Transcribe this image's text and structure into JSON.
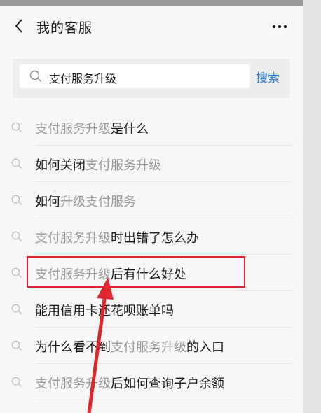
{
  "navbar": {
    "title": "我的客服",
    "back_icon": "chevron-left-icon",
    "more_icon": "more-horizontal-icon"
  },
  "search": {
    "value": "支付服务升级",
    "button_label": "搜索",
    "icon": "search-icon"
  },
  "suggestions": [
    [
      {
        "t": "支付服务升级",
        "h": true
      },
      {
        "t": "是什么",
        "h": false
      }
    ],
    [
      {
        "t": "如何关闭",
        "h": false
      },
      {
        "t": "支付服务升级",
        "h": true
      }
    ],
    [
      {
        "t": "如何",
        "h": false
      },
      {
        "t": "升级支付服务",
        "h": true
      }
    ],
    [
      {
        "t": "支付服务升级",
        "h": true
      },
      {
        "t": "时出错了怎么办",
        "h": false
      }
    ],
    [
      {
        "t": "支付服务升级",
        "h": true
      },
      {
        "t": "后有什么好处",
        "h": false
      }
    ],
    [
      {
        "t": "能用信用卡还花呗账单吗",
        "h": false
      }
    ],
    [
      {
        "t": "为什么看不到",
        "h": false
      },
      {
        "t": "支付服务升级",
        "h": true
      },
      {
        "t": "的入口",
        "h": false
      }
    ],
    [
      {
        "t": "支付服务升级",
        "h": true
      },
      {
        "t": "后如何查询子户余额",
        "h": false
      }
    ]
  ],
  "annotation": {
    "highlighted_index": 4,
    "color": "#e0262d"
  },
  "colors": {
    "accent": "#2f7bd8",
    "highlight_text": "#9a9a9a",
    "text": "#1a1a1a"
  }
}
